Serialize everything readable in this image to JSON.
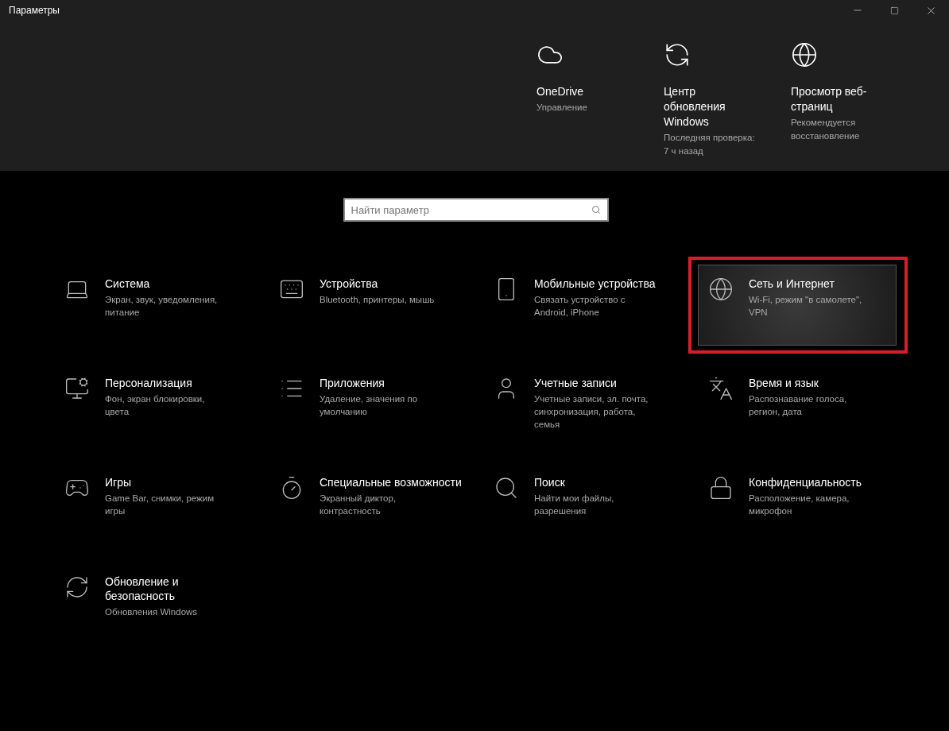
{
  "window": {
    "title": "Параметры"
  },
  "header_items": [
    {
      "title": "OneDrive",
      "subtitle": "Управление"
    },
    {
      "title": "Центр обновления Windows",
      "subtitle": "Последняя проверка: 7 ч назад"
    },
    {
      "title": "Просмотр веб-страниц",
      "subtitle": "Рекомендуется восстановление"
    }
  ],
  "search": {
    "placeholder": "Найти параметр"
  },
  "categories": [
    {
      "title": "Система",
      "description": "Экран, звук, уведомления, питание",
      "selected": false,
      "highlighted": false
    },
    {
      "title": "Устройства",
      "description": "Bluetooth, принтеры, мышь",
      "selected": false,
      "highlighted": false
    },
    {
      "title": "Мобильные устройства",
      "description": "Связать устройство с Android, iPhone",
      "selected": false,
      "highlighted": false
    },
    {
      "title": "Сеть и Интернет",
      "description": "Wi-Fi, режим \"в самолете\", VPN",
      "selected": true,
      "highlighted": true
    },
    {
      "title": "Персонализация",
      "description": "Фон, экран блокировки, цвета",
      "selected": false,
      "highlighted": false
    },
    {
      "title": "Приложения",
      "description": "Удаление, значения по умолчанию",
      "selected": false,
      "highlighted": false
    },
    {
      "title": "Учетные записи",
      "description": "Учетные записи, эл. почта, синхронизация, работа, семья",
      "selected": false,
      "highlighted": false
    },
    {
      "title": "Время и язык",
      "description": "Распознавание голоса, регион, дата",
      "selected": false,
      "highlighted": false
    },
    {
      "title": "Игры",
      "description": "Game Bar, снимки, режим игры",
      "selected": false,
      "highlighted": false
    },
    {
      "title": "Специальные возможности",
      "description": "Экранный диктор, контрастность",
      "selected": false,
      "highlighted": false
    },
    {
      "title": "Поиск",
      "description": "Найти мои файлы, разрешения",
      "selected": false,
      "highlighted": false
    },
    {
      "title": "Конфиденциальность",
      "description": "Расположение, камера, микрофон",
      "selected": false,
      "highlighted": false
    },
    {
      "title": "Обновление и безопасность",
      "description": "Обновления Windows",
      "selected": false,
      "highlighted": false
    }
  ]
}
